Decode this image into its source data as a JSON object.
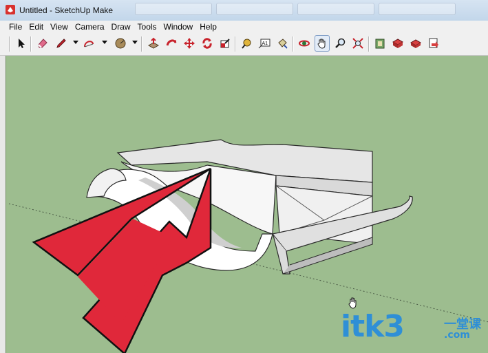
{
  "window": {
    "title": "Untitled - SketchUp Make"
  },
  "menu": [
    {
      "label": "File"
    },
    {
      "label": "Edit"
    },
    {
      "label": "View"
    },
    {
      "label": "Camera"
    },
    {
      "label": "Draw"
    },
    {
      "label": "Tools"
    },
    {
      "label": "Window"
    },
    {
      "label": "Help"
    }
  ],
  "toolbar": {
    "tools": [
      {
        "name": "select",
        "icon": "cursor-arrow-icon"
      },
      {
        "name": "eraser",
        "icon": "eraser-icon"
      },
      {
        "name": "line",
        "icon": "pencil-icon"
      },
      {
        "name": "arc",
        "icon": "arc-icon"
      },
      {
        "name": "shapes",
        "icon": "circle-shape-icon"
      },
      {
        "name": "push-pull",
        "icon": "push-pull-icon"
      },
      {
        "name": "follow-me",
        "icon": "follow-me-icon"
      },
      {
        "name": "move",
        "icon": "move-icon"
      },
      {
        "name": "rotate",
        "icon": "rotate-icon"
      },
      {
        "name": "scale",
        "icon": "scale-icon"
      },
      {
        "name": "tape-measure",
        "icon": "tape-measure-icon"
      },
      {
        "name": "text",
        "icon": "text-icon",
        "label": "A1"
      },
      {
        "name": "paint-bucket",
        "icon": "paint-bucket-icon"
      },
      {
        "name": "orbit",
        "icon": "orbit-icon"
      },
      {
        "name": "pan",
        "icon": "pan-hand-icon",
        "active": true
      },
      {
        "name": "zoom",
        "icon": "zoom-icon"
      },
      {
        "name": "zoom-extents",
        "icon": "zoom-extents-icon"
      },
      {
        "name": "3d-warehouse",
        "icon": "warehouse-icon"
      },
      {
        "name": "extension-warehouse",
        "icon": "extension-warehouse-icon"
      },
      {
        "name": "share-model",
        "icon": "share-model-icon"
      },
      {
        "name": "layout",
        "icon": "send-to-layout-icon"
      }
    ]
  },
  "watermark": {
    "main": "itk3",
    "cn": "一堂课",
    "domain": ".com"
  },
  "colors": {
    "viewport": "#9dbd8f",
    "arrow": "#e0283a",
    "model": "#f2f2f2"
  }
}
